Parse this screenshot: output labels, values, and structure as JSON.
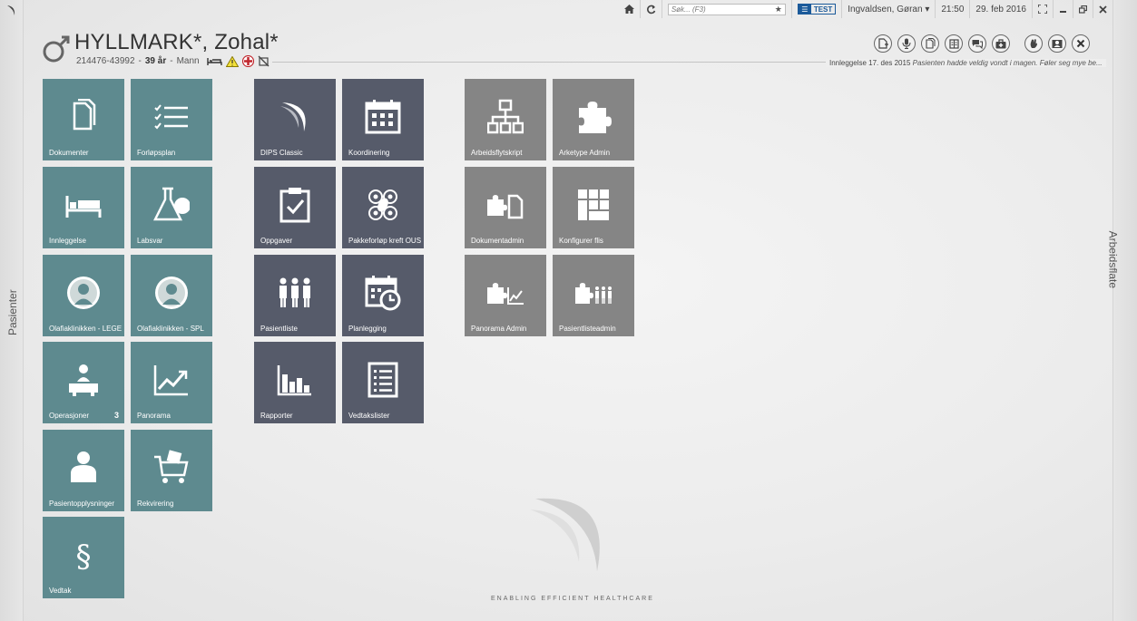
{
  "sidebar_left": {
    "label": "Pasienter"
  },
  "sidebar_right": {
    "label": "Arbeidsflate"
  },
  "topbar": {
    "search_placeholder": "Søk... (F3)",
    "env_badge": "TEST",
    "user": "Ingvaldsen, Gøran ▾",
    "time": "21:50",
    "date": "29. feb 2016"
  },
  "patient": {
    "name": "HYLLMARK*, Zohal*",
    "id": "214476-43992",
    "sep1": "-",
    "age": "39 år",
    "sep2": "-",
    "gender": "Mann"
  },
  "admission": {
    "prefix": "Innleggelse 17. des 2015",
    "note": "Pasienten hadde veldig vondt i magen. Føler seg mye be..."
  },
  "tiles": {
    "dokumenter": "Dokumenter",
    "forlopsplan": "Forløpsplan",
    "innleggelse": "Innleggelse",
    "labsvar": "Labsvar",
    "olafia_lege": "Olafiaklinikken - LEGE",
    "olafia_spl": "Olafiaklinikken - SPL",
    "operasjoner": "Operasjoner",
    "operasjoner_count": "3",
    "panorama": "Panorama",
    "pasientopplysninger": "Pasientopplysninger",
    "rekvirering": "Rekvirering",
    "vedtak": "Vedtak",
    "dips_classic": "DIPS Classic",
    "koordinering": "Koordinering",
    "oppgaver": "Oppgaver",
    "pakkeforlop": "Pakkeforløp kreft OUS",
    "pasientliste": "Pasientliste",
    "planlegging": "Planlegging",
    "rapporter": "Rapporter",
    "vedtakslister": "Vedtakslister",
    "arbeidsflytskript": "Arbeidsflytskript",
    "arketype_admin": "Arketype Admin",
    "dokumentadmin": "Dokumentadmin",
    "konfigurer_flis": "Konfigurer flis",
    "panorama_admin": "Panorama Admin",
    "pasientlisteadmin": "Pasientlisteadmin"
  },
  "icons": {
    "tile_colors": {
      "teal": "#5e8a8f",
      "slate": "#565b6a",
      "gray": "#858585"
    }
  },
  "brand": {
    "tagline": "ENABLING EFFICIENT HEALTHCARE"
  }
}
